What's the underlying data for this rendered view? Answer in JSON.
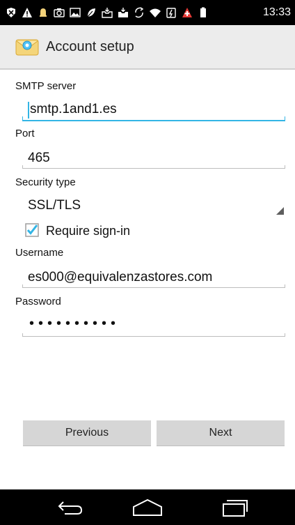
{
  "status_bar": {
    "time": "13:33",
    "icons": [
      "usb-debug-icon",
      "warning-icon",
      "bell-icon",
      "camera-icon",
      "image-icon",
      "leaf-icon",
      "inbox-icon",
      "inbox-icon-2",
      "sync-icon",
      "wifi-icon",
      "battery-charging-icon",
      "alert-icon",
      "battery-icon"
    ]
  },
  "action_bar": {
    "title": "Account setup",
    "icon": "email-envelope-icon"
  },
  "form": {
    "smtp_label": "SMTP server",
    "smtp_value": "smtp.1and1.es",
    "port_label": "Port",
    "port_value": "465",
    "security_label": "Security type",
    "security_value": "SSL/TLS",
    "require_signin_label": "Require sign-in",
    "require_signin_checked": true,
    "username_label": "Username",
    "username_value": "es000@equivalenzastores.com",
    "password_label": "Password",
    "password_value": "••••••••••"
  },
  "buttons": {
    "previous": "Previous",
    "next": "Next"
  },
  "nav_bar": {
    "icons": [
      "back-icon",
      "home-icon",
      "recents-icon"
    ]
  },
  "colors": {
    "accent": "#33b5e5",
    "action_bar": "#ececec",
    "button": "#d6d6d6"
  }
}
